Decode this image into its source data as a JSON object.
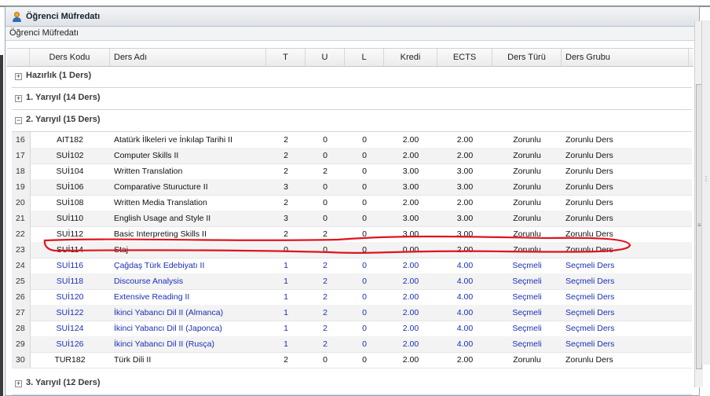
{
  "panel": {
    "title": "Öğrenci Müfredatı",
    "subtitle": "Öğrenci Müfredatı"
  },
  "columns": {
    "code": "Ders Kodu",
    "name": "Ders Adı",
    "t": "T",
    "u": "U",
    "l": "L",
    "kredi": "Kredi",
    "ects": "ECTS",
    "type": "Ders Türü",
    "group": "Ders Grubu"
  },
  "groups": {
    "hazirlik": "Hazırlık (1 Ders)",
    "y1": "1. Yarıyıl (14 Ders)",
    "y2": "2. Yarıyıl (15 Ders)",
    "y3": "3. Yarıyıl (12 Ders)"
  },
  "toggles": {
    "plus": "+",
    "minus": "−"
  },
  "rows": [
    {
      "n": "16",
      "code": "AIT182",
      "name": "Atatürk İlkeleri ve İnkılap Tarihi II",
      "t": "2",
      "u": "0",
      "l": "0",
      "kredi": "2.00",
      "ects": "2.00",
      "type": "Zorunlu",
      "group": "Zorunlu Ders"
    },
    {
      "n": "17",
      "code": "SUİ102",
      "name": "Computer Skills II",
      "t": "2",
      "u": "0",
      "l": "0",
      "kredi": "2.00",
      "ects": "2.00",
      "type": "Zorunlu",
      "group": "Zorunlu Ders"
    },
    {
      "n": "18",
      "code": "SUİ104",
      "name": "Written Translation",
      "t": "2",
      "u": "2",
      "l": "0",
      "kredi": "3.00",
      "ects": "3.00",
      "type": "Zorunlu",
      "group": "Zorunlu Ders"
    },
    {
      "n": "19",
      "code": "SUİ106",
      "name": "Comparative Sturucture II",
      "t": "3",
      "u": "0",
      "l": "0",
      "kredi": "3.00",
      "ects": "3.00",
      "type": "Zorunlu",
      "group": "Zorunlu Ders"
    },
    {
      "n": "20",
      "code": "SUİ108",
      "name": "Written Media Translation",
      "t": "2",
      "u": "0",
      "l": "0",
      "kredi": "2.00",
      "ects": "2.00",
      "type": "Zorunlu",
      "group": "Zorunlu Ders"
    },
    {
      "n": "21",
      "code": "SUİ110",
      "name": "English Usage and Style II",
      "t": "3",
      "u": "0",
      "l": "0",
      "kredi": "3.00",
      "ects": "3.00",
      "type": "Zorunlu",
      "group": "Zorunlu Ders"
    },
    {
      "n": "22",
      "code": "SUİ112",
      "name": "Basic Interpreting Skills II",
      "t": "2",
      "u": "2",
      "l": "0",
      "kredi": "3.00",
      "ects": "3.00",
      "type": "Zorunlu",
      "group": "Zorunlu Ders"
    },
    {
      "n": "23",
      "code": "SUİ114",
      "name": "Staj",
      "t": "0",
      "u": "0",
      "l": "0",
      "kredi": "0.00",
      "ects": "2.00",
      "type": "Zorunlu",
      "group": "Zorunlu Ders"
    },
    {
      "n": "24",
      "code": "SUİ116",
      "name": "Çağdaş Türk Edebiyatı II",
      "t": "1",
      "u": "2",
      "l": "0",
      "kredi": "2.00",
      "ects": "4.00",
      "type": "Seçmeli",
      "group": "Seçmeli Ders"
    },
    {
      "n": "25",
      "code": "SUİ118",
      "name": "Discourse Analysis",
      "t": "1",
      "u": "2",
      "l": "0",
      "kredi": "2.00",
      "ects": "4.00",
      "type": "Seçmeli",
      "group": "Seçmeli Ders"
    },
    {
      "n": "26",
      "code": "SUİ120",
      "name": "Extensive Reading II",
      "t": "1",
      "u": "2",
      "l": "0",
      "kredi": "2.00",
      "ects": "4.00",
      "type": "Seçmeli",
      "group": "Seçmeli Ders"
    },
    {
      "n": "27",
      "code": "SUİ122",
      "name": "İkinci Yabancı Dil II (Almanca)",
      "t": "1",
      "u": "2",
      "l": "0",
      "kredi": "2.00",
      "ects": "4.00",
      "type": "Seçmeli",
      "group": "Seçmeli Ders"
    },
    {
      "n": "28",
      "code": "SUİ124",
      "name": "İkinci Yabancı Dil II (Japonca)",
      "t": "1",
      "u": "2",
      "l": "0",
      "kredi": "2.00",
      "ects": "4.00",
      "type": "Seçmeli",
      "group": "Seçmeli Ders"
    },
    {
      "n": "29",
      "code": "SUİ126",
      "name": "İkinci Yabancı Dil II (Rusça)",
      "t": "1",
      "u": "2",
      "l": "0",
      "kredi": "2.00",
      "ects": "4.00",
      "type": "Seçmeli",
      "group": "Seçmeli Ders"
    },
    {
      "n": "30",
      "code": "TUR182",
      "name": "Türk Dili II",
      "t": "2",
      "u": "0",
      "l": "0",
      "kredi": "2.00",
      "ects": "2.00",
      "type": "Zorunlu",
      "group": "Zorunlu Ders"
    }
  ],
  "colors": {
    "elective_text": "#1a2fb8",
    "annotation": "#e0141e"
  },
  "icons": {
    "panel": "user-icon",
    "scroll_grip": "grip-icon"
  }
}
